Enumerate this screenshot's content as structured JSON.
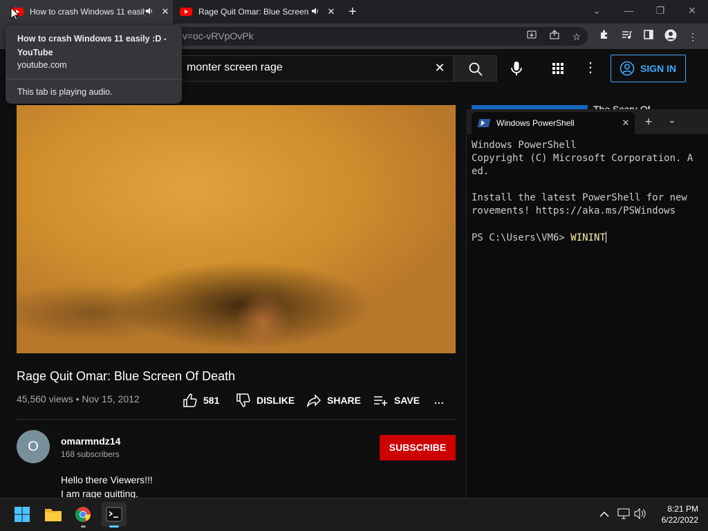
{
  "browser": {
    "tabs": [
      {
        "title": "How to crash Windows 11 easily :D - YouTube",
        "favicon": "youtube-icon",
        "audio_icon": "speaker-icon"
      },
      {
        "title": "Rage Quit Omar: Blue Screen Of Death",
        "favicon": "youtube-icon",
        "audio_icon": "speaker-icon"
      }
    ],
    "new_tab_glyph": "+",
    "url_visible": "?v=oc-vRVpOvPk",
    "tooltip": {
      "title": "How to crash Windows 11 easily :D - YouTube",
      "domain": "youtube.com",
      "status": "This tab is playing audio."
    }
  },
  "youtube": {
    "search_query": "monter screen rage",
    "sign_in_label": "SIGN IN",
    "video": {
      "title": "Rage Quit Omar: Blue Screen Of Death",
      "meta": "45,560 views • Nov 15, 2012",
      "likes": "581",
      "dislike_label": "DISLIKE",
      "share_label": "SHARE",
      "save_label": "SAVE",
      "more_glyph": "..."
    },
    "channel": {
      "avatar_letter": "O",
      "name": "omarmndz14",
      "subscribers": "168 subscribers",
      "subscribe_label": "SUBSCRIBE"
    },
    "description": [
      "Hello there Viewers!!!",
      "I am rage quitting."
    ],
    "sidebar_peek_text": "The Scary Of"
  },
  "powershell": {
    "tab_title": "Windows PowerShell",
    "lines": [
      "Windows PowerShell",
      "Copyright (C) Microsoft Corporation. A",
      "ed.",
      "",
      "Install the latest PowerShell for new",
      "rovements! https://aka.ms/PSWindows",
      ""
    ],
    "prompt": "PS C:\\Users\\VM6> ",
    "typed": "WININT"
  },
  "taskbar": {
    "time": "8:21 PM",
    "date": "6/22/2022"
  },
  "colors": {
    "youtube_red": "#ff0000",
    "subscribe_red": "#cc0000",
    "link_blue": "#3ea6ff",
    "ps_typed_yellow": "#f9f1a5"
  }
}
